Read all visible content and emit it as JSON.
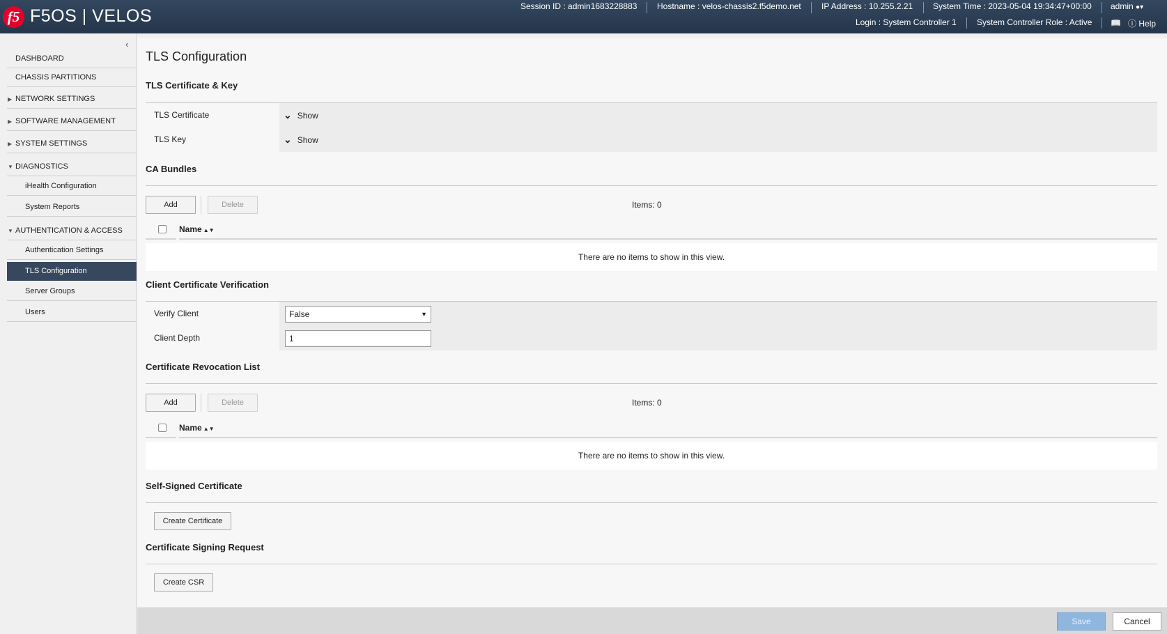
{
  "header": {
    "logo_text": "f5",
    "brand": "F5OS | VELOS",
    "session_id": "Session ID : admin1683228883",
    "hostname": "Hostname : velos-chassis2.f5demo.net",
    "ip_address": "IP Address : 10.255.2.21",
    "system_time": "System Time : 2023-05-04 19:34:47+00:00",
    "user": "admin",
    "login": "Login : System Controller 1",
    "controller_role": "System Controller Role : Active",
    "help": "Help",
    "icons": {
      "user": "user-icon",
      "docs": "book-icon",
      "help": "help-circle-icon"
    }
  },
  "sidebar": {
    "collapse_icon": "chevron-left-icon",
    "items": [
      {
        "label": "DASHBOARD",
        "level": "top"
      },
      {
        "label": "CHASSIS PARTITIONS",
        "level": "top"
      },
      {
        "label": "NETWORK SETTINGS",
        "level": "top",
        "expandable": true,
        "expanded": false
      },
      {
        "label": "SOFTWARE MANAGEMENT",
        "level": "top",
        "expandable": true,
        "expanded": false
      },
      {
        "label": "SYSTEM SETTINGS",
        "level": "top",
        "expandable": true,
        "expanded": false
      },
      {
        "label": "DIAGNOSTICS",
        "level": "top",
        "expandable": true,
        "expanded": true
      },
      {
        "label": "iHealth Configuration",
        "level": "sub"
      },
      {
        "label": "System Reports",
        "level": "sub"
      },
      {
        "label": "AUTHENTICATION & ACCESS",
        "level": "top",
        "expandable": true,
        "expanded": true
      },
      {
        "label": "Authentication Settings",
        "level": "sub"
      },
      {
        "label": "TLS Configuration",
        "level": "sub",
        "active": true
      },
      {
        "label": "Server Groups",
        "level": "sub"
      },
      {
        "label": "Users",
        "level": "sub"
      }
    ]
  },
  "main": {
    "title": "TLS Configuration",
    "tls_section": {
      "title": "TLS Certificate & Key",
      "rows": [
        {
          "label": "TLS Certificate",
          "toggle": "Show"
        },
        {
          "label": "TLS Key",
          "toggle": "Show"
        }
      ]
    },
    "ca_bundles": {
      "title": "CA Bundles",
      "add": "Add",
      "delete": "Delete",
      "items": "Items: 0",
      "column_name": "Name",
      "empty": "There are no items to show in this view."
    },
    "client_verification": {
      "title": "Client Certificate Verification",
      "verify_label": "Verify Client",
      "verify_value": "False",
      "depth_label": "Client Depth",
      "depth_value": "1"
    },
    "crl": {
      "title": "Certificate Revocation List",
      "add": "Add",
      "delete": "Delete",
      "items": "Items: 0",
      "column_name": "Name",
      "empty": "There are no items to show in this view."
    },
    "self_signed": {
      "title": "Self-Signed Certificate",
      "button": "Create Certificate"
    },
    "csr": {
      "title": "Certificate Signing Request",
      "button": "Create CSR"
    }
  },
  "footer": {
    "save": "Save",
    "cancel": "Cancel"
  },
  "colors": {
    "header_bg": "#2b3d52",
    "active_nav": "#37475e",
    "brand_red": "#e4002b",
    "save_disabled": "#8fb6de"
  }
}
